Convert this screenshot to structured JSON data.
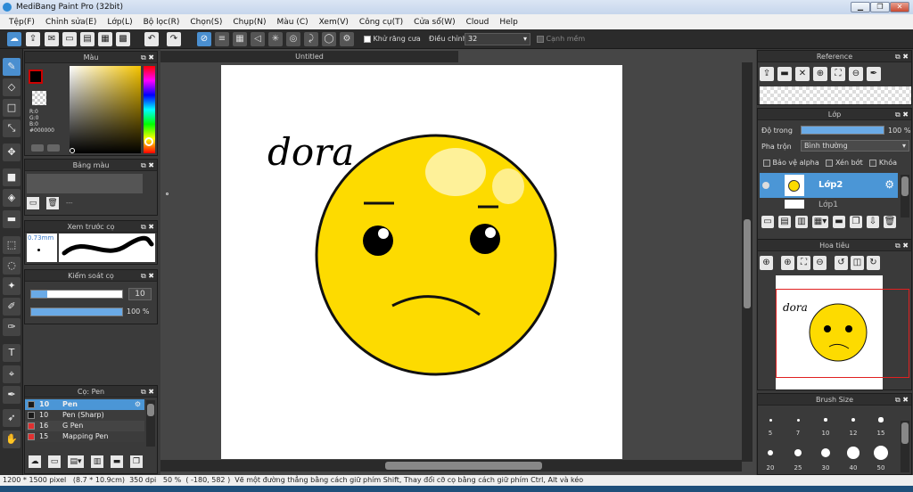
{
  "window": {
    "title": "MediBang Paint Pro (32bit)"
  },
  "menu": [
    "Tệp(F)",
    "Chỉnh sửa(E)",
    "Lớp(L)",
    "Bộ lọc(R)",
    "Chọn(S)",
    "Chụp(N)",
    "Màu (C)",
    "Xem(V)",
    "Công cụ(T)",
    "Cửa sổ(W)",
    "Cloud",
    "Help"
  ],
  "toolbar": {
    "antialias_label": "Khử răng cưa",
    "correction_label": "Điều chỉnh",
    "correction_value": "32",
    "edge_label": "Cạnh mềm"
  },
  "color_panel": {
    "title": "Màu",
    "r": "R:0",
    "g": "G:0",
    "b": "B:0",
    "hex": "#000000",
    "fg": "#000000"
  },
  "palette_panel": {
    "title": "Bảng màu",
    "dash": "---"
  },
  "preview_panel": {
    "title": "Xem trước cọ",
    "size": "0.73mm"
  },
  "control_panel": {
    "title": "Kiểm soát cọ",
    "size_value": "10",
    "opacity_value": "100 %",
    "opacity": 1.0
  },
  "brush_panel": {
    "title": "Cọ: Pen",
    "items": [
      {
        "size": "10",
        "name": "Pen",
        "color": "#1a1a1a",
        "selected": true
      },
      {
        "size": "10",
        "name": "Pen (Sharp)",
        "color": "#1a1a1a",
        "selected": false
      },
      {
        "size": "16",
        "name": "G Pen",
        "color": "#e03030",
        "selected": false
      },
      {
        "size": "15",
        "name": "Mapping Pen",
        "color": "#e03030",
        "selected": false
      }
    ]
  },
  "canvas": {
    "tab": "Untitled",
    "handwriting": "dora"
  },
  "reference_panel": {
    "title": "Reference"
  },
  "layer_panel": {
    "title": "Lớp",
    "opacity_label": "Độ trong",
    "opacity_value": "100 %",
    "blend_label": "Pha trộn",
    "blend_value": "Bình thường",
    "protect_alpha": "Bảo vệ alpha",
    "clipping": "Xén bớt",
    "lock": "Khóa",
    "layer_name": "Lớp2",
    "layer_name2": "Lớp1"
  },
  "navigator_panel": {
    "title": "Hoa tiêu"
  },
  "brush_size_panel": {
    "title": "Brush Size",
    "sizes": [
      "5",
      "7",
      "10",
      "12",
      "15",
      "20",
      "25",
      "30",
      "40",
      "50"
    ]
  },
  "status": {
    "size": "1200 * 1500 pixel",
    "cm": "(8.7 * 10.9cm)",
    "dpi": "350 dpi",
    "zoom": "50 %",
    "coords": "( -180, 582 )",
    "hint": "Vẽ một đường thẳng bằng cách giữ phím Shift, Thay đổi cỡ cọ bằng cách giữ phím Ctrl, Alt và kéo"
  }
}
